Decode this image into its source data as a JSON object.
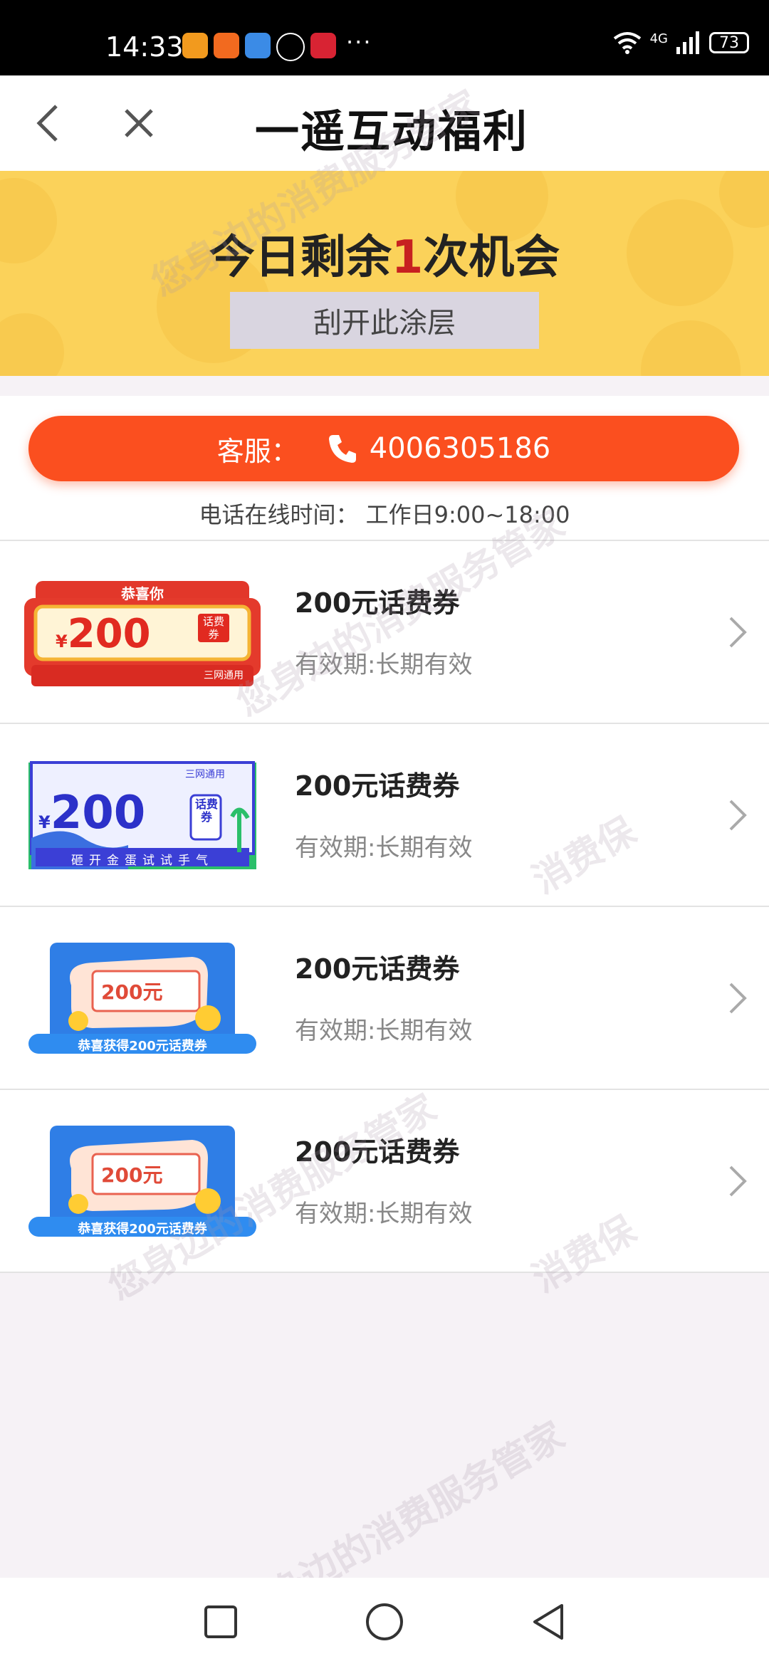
{
  "status_bar": {
    "time": "14:33",
    "network": "4G",
    "battery": "73"
  },
  "header": {
    "title": "一遥互动福利"
  },
  "scratch": {
    "line_prefix": "今日剩余",
    "count": "1",
    "line_suffix": "次机会",
    "button_label": "刮开此涂层"
  },
  "service": {
    "label": "客服：",
    "phone": "4006305186",
    "hours": "电话在线时间：  工作日9:00~18:00"
  },
  "coupons": [
    {
      "title": "200元话费券",
      "validity": "有效期:长期有效",
      "thumb": {
        "headline": "恭喜你",
        "amount": "200",
        "badge": "话费券",
        "footer": "三网通用"
      }
    },
    {
      "title": "200元话费券",
      "validity": "有效期:长期有效",
      "thumb": {
        "amount": "200",
        "badge": "话费券",
        "footer": "砸开金蛋试试手气",
        "top": "三网通用"
      }
    },
    {
      "title": "200元话费券",
      "validity": "有效期:长期有效",
      "thumb": {
        "amount": "200元",
        "footer": "恭喜获得200元话费券"
      }
    },
    {
      "title": "200元话费券",
      "validity": "有效期:长期有效",
      "thumb": {
        "amount": "200元",
        "footer": "恭喜获得200元话费券"
      }
    }
  ],
  "watermark": "您身边的消费服务管家",
  "watermark2": "消费保",
  "colors": {
    "accent": "#fb4f1f",
    "banner": "#fbd25a",
    "highlight": "#c72020"
  }
}
